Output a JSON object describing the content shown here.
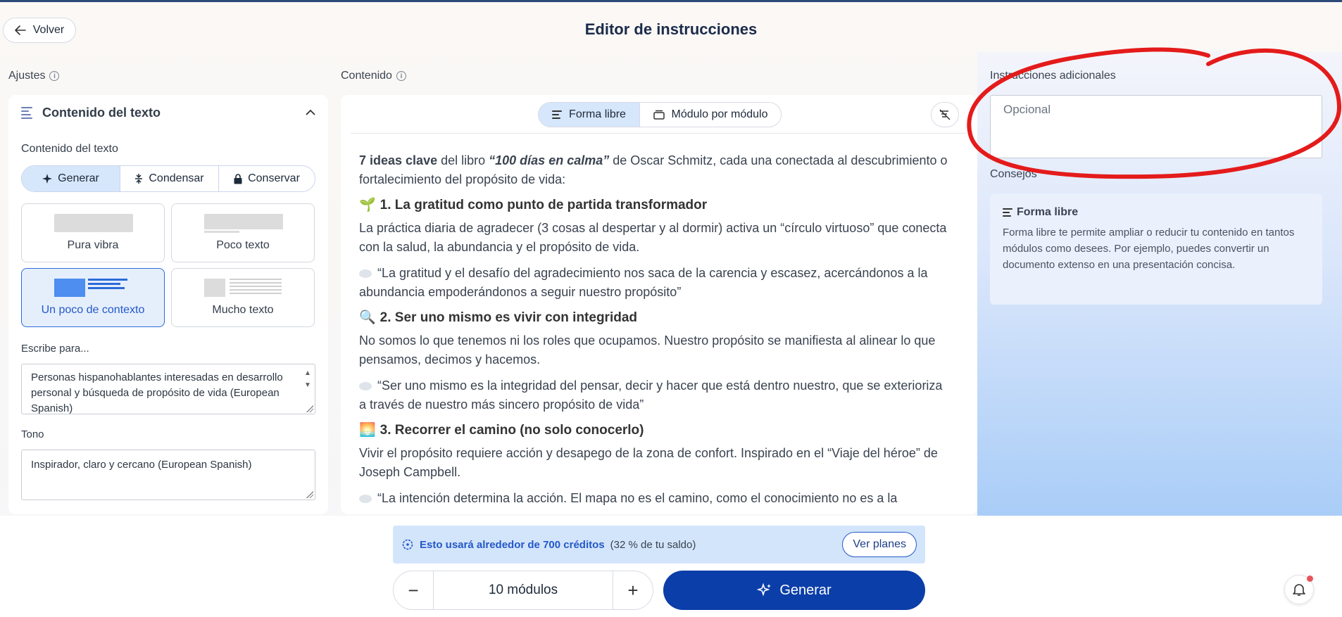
{
  "header": {
    "back_label": "Volver",
    "title": "Editor de instrucciones"
  },
  "left": {
    "section_label": "Ajustes",
    "panel_title": "Contenido del texto",
    "content_label": "Contenido del texto",
    "modes": [
      {
        "label": "Generar",
        "icon": "sparkle-icon",
        "active": true
      },
      {
        "label": "Condensar",
        "icon": "condense-icon",
        "active": false
      },
      {
        "label": "Conservar",
        "icon": "lock-icon",
        "active": false
      }
    ],
    "amount_cards": [
      {
        "label": "Pura vibra",
        "active": false
      },
      {
        "label": "Poco texto",
        "active": false
      },
      {
        "label": "Un poco de contexto",
        "active": true
      },
      {
        "label": "Mucho texto",
        "active": false
      }
    ],
    "audience_label": "Escribe para...",
    "audience_value": "Personas hispanohablantes interesadas en desarrollo personal y búsqueda de propósito de vida (European Spanish)",
    "tone_label": "Tono",
    "tone_value": "Inspirador, claro y cercano (European Spanish)"
  },
  "middle": {
    "section_label": "Contenido",
    "tab_free": "Forma libre",
    "tab_module": "Módulo por módulo",
    "intro_bold": "7 ideas clave",
    "intro_mid": " del libro ",
    "intro_italic": "“100 días en calma”",
    "intro_rest": " de Oscar Schmitz, cada una conectada al descubrimiento o fortalecimiento del propósito de vida:",
    "ideas": [
      {
        "emoji": "🌱",
        "title": "1. La gratitud como punto de partida transformador",
        "body": "La práctica diaria de agradecer (3 cosas al despertar y al dormir) activa un “círculo virtuoso” que conecta con la salud, la abundancia y el propósito de vida.",
        "quote": "“La gratitud y el desafío del agradecimiento nos saca de la carencia y escasez, acercándonos a la abundancia empoderándonos a seguir nuestro propósito”"
      },
      {
        "emoji": "🔍",
        "title": "2. Ser uno mismo es vivir con integridad",
        "body": "No somos lo que tenemos ni los roles que ocupamos. Nuestro propósito se manifiesta al alinear lo que pensamos, decimos y hacemos.",
        "quote": "“Ser uno mismo es la integridad del pensar, decir y hacer que está dentro nuestro, que se exterioriza a través de nuestro más sincero propósito de vida”"
      },
      {
        "emoji": "🌅",
        "title": "3. Recorrer el camino (no solo conocerlo)",
        "body": "Vivir el propósito requiere acción y desapego de la zona de confort. Inspirado en el “Viaje del héroe” de Joseph Campbell.",
        "quote": "“La intención determina la acción. El mapa no es el camino, como el conocimiento no es a la"
      }
    ]
  },
  "right": {
    "label": "Instrucciones adicionales",
    "placeholder": "Opcional",
    "tips_label": "Consejos",
    "tip_title": "Forma libre",
    "tip_text": "Forma libre te permite ampliar o reducir tu contenido en tantos módulos como desees. Por ejemplo, puedes convertir un documento extenso en una presentación concisa."
  },
  "bottom": {
    "credits_main": "Esto usará alrededor de 700 créditos",
    "credits_sub": "(32 % de tu saldo)",
    "plans_label": "Ver planes",
    "modules_value": "10 módulos",
    "decrement": "−",
    "increment": "+",
    "generate_label": "Generar"
  },
  "colors": {
    "accent": "#0b3ea8",
    "active_bg": "#d6e6fb",
    "annotation_red": "#e41b1b"
  }
}
